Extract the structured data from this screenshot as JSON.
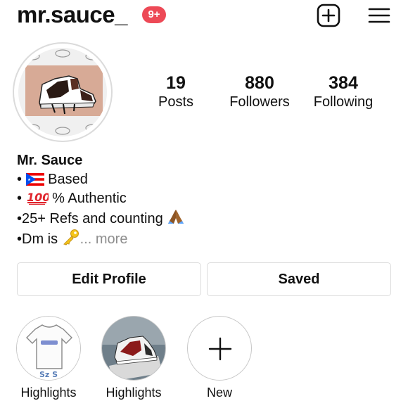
{
  "header": {
    "username": "mr.sauce_",
    "notification_badge": "9+"
  },
  "stats": [
    {
      "value": "19",
      "label": "Posts"
    },
    {
      "value": "880",
      "label": "Followers"
    },
    {
      "value": "384",
      "label": "Following"
    }
  ],
  "bio": {
    "name": "Mr. Sauce",
    "line1_text": "Based",
    "line2_text": "% Authentic",
    "line3_text": "•25+ Refs and counting",
    "line4_text": "•Dm is",
    "more": "... more"
  },
  "buttons": {
    "edit_profile": "Edit Profile",
    "saved": "Saved"
  },
  "highlights": [
    {
      "label": "Highlights",
      "shirt_text": "Sz S"
    },
    {
      "label": "Highlights"
    },
    {
      "label": "New"
    }
  ],
  "colors": {
    "badge": "#ed4956",
    "border": "#dbdbdb",
    "secondary_text": "#8e8e8e"
  },
  "icons": [
    "plus-square-icon",
    "hamburger-menu-icon",
    "puerto-rico-flag-icon",
    "hundred-points-icon",
    "folded-hands-icon",
    "key-icon",
    "plus-icon"
  ]
}
